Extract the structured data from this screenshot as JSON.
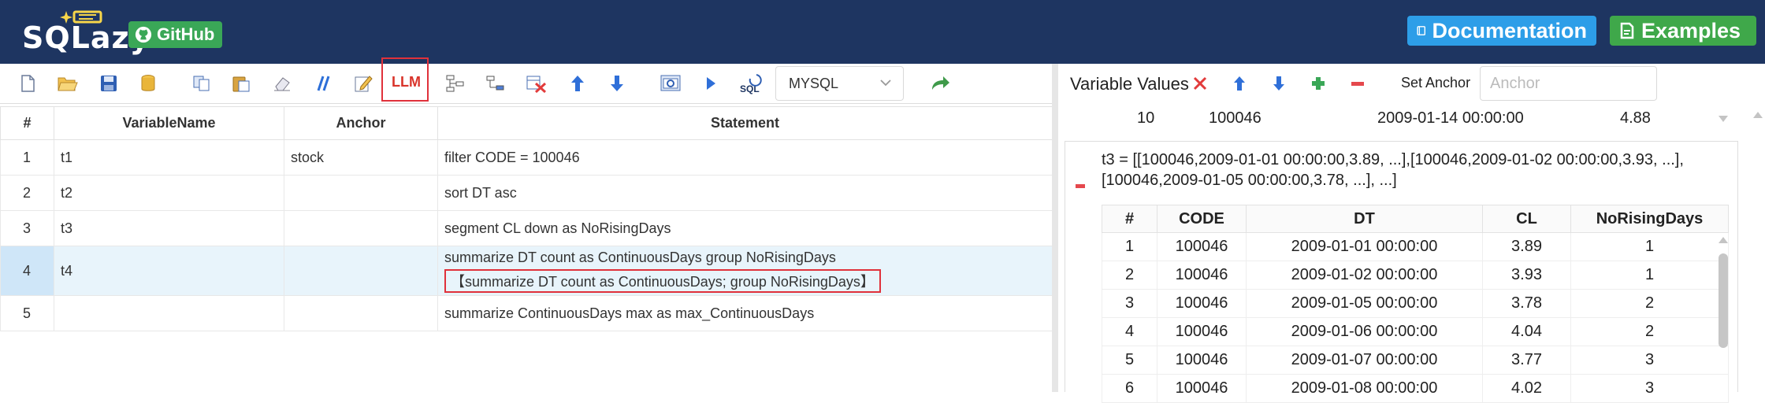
{
  "header": {
    "logo_text": "SQLazy",
    "github_label": "GitHub",
    "docs_label": "Documentation",
    "examples_label": "Examples"
  },
  "toolbar": {
    "llm_label": "LLM",
    "db_select_value": "MYSQL"
  },
  "steps_table": {
    "columns": [
      "#",
      "VariableName",
      "Anchor",
      "Statement"
    ],
    "rows": [
      {
        "num": "1",
        "var": "t1",
        "anchor": "stock",
        "stmt": "filter CODE = 100046",
        "hint": ""
      },
      {
        "num": "2",
        "var": "t2",
        "anchor": "",
        "stmt": "sort DT asc",
        "hint": ""
      },
      {
        "num": "3",
        "var": "t3",
        "anchor": "",
        "stmt": "segment CL down as NoRisingDays",
        "hint": ""
      },
      {
        "num": "4",
        "var": "t4",
        "anchor": "",
        "stmt": "summarize DT count as ContinuousDays group NoRisingDays",
        "hint": "【summarize DT count as ContinuousDays; group NoRisingDays】"
      },
      {
        "num": "5",
        "var": "",
        "anchor": "",
        "stmt": "summarize ContinuousDays max as max_ContinuousDays",
        "hint": ""
      }
    ]
  },
  "variables_panel": {
    "title": "Variable Values",
    "set_anchor_label": "Set Anchor",
    "anchor_placeholder": "Anchor",
    "prev_row": {
      "num": "10",
      "code": "100046",
      "dt": "2009-01-14 00:00:00",
      "cl": "4.88"
    },
    "t3_description": "t3 = [[100046,2009-01-01 00:00:00,3.89, ...],[100046,2009-01-02 00:00:00,3.93, ...],[100046,2009-01-05 00:00:00,3.78, ...], ...]",
    "t3_columns": [
      "#",
      "CODE",
      "DT",
      "CL",
      "NoRisingDays"
    ],
    "t3_rows": [
      [
        "1",
        "100046",
        "2009-01-01 00:00:00",
        "3.89",
        "1"
      ],
      [
        "2",
        "100046",
        "2009-01-02 00:00:00",
        "3.93",
        "1"
      ],
      [
        "3",
        "100046",
        "2009-01-05 00:00:00",
        "3.78",
        "2"
      ],
      [
        "4",
        "100046",
        "2009-01-06 00:00:00",
        "4.04",
        "2"
      ],
      [
        "5",
        "100046",
        "2009-01-07 00:00:00",
        "3.77",
        "3"
      ],
      [
        "6",
        "100046",
        "2009-01-08 00:00:00",
        "4.02",
        "3"
      ]
    ]
  },
  "icons": {
    "new": "new-file-icon",
    "open": "open-folder-icon",
    "save": "save-icon",
    "db": "database-icon",
    "copy": "copy-icon",
    "paste": "paste-icon",
    "erase": "eraser-icon",
    "comment": "comment-icon",
    "edit": "edit-icon",
    "insert_step": "insert-step-icon",
    "append_step": "append-step-icon",
    "delete_step": "delete-step-icon",
    "up": "move-up-icon",
    "down": "move-down-icon",
    "preview": "preview-icon",
    "run": "run-icon",
    "sql": "sql-icon",
    "redo": "redo-icon"
  },
  "colors": {
    "header_bg": "#1e3561",
    "github": "#3aa757",
    "docs": "#2d9ee8",
    "examples": "#3fa84a",
    "highlight": "#e0313b",
    "selected_row": "#e8f4fb"
  }
}
